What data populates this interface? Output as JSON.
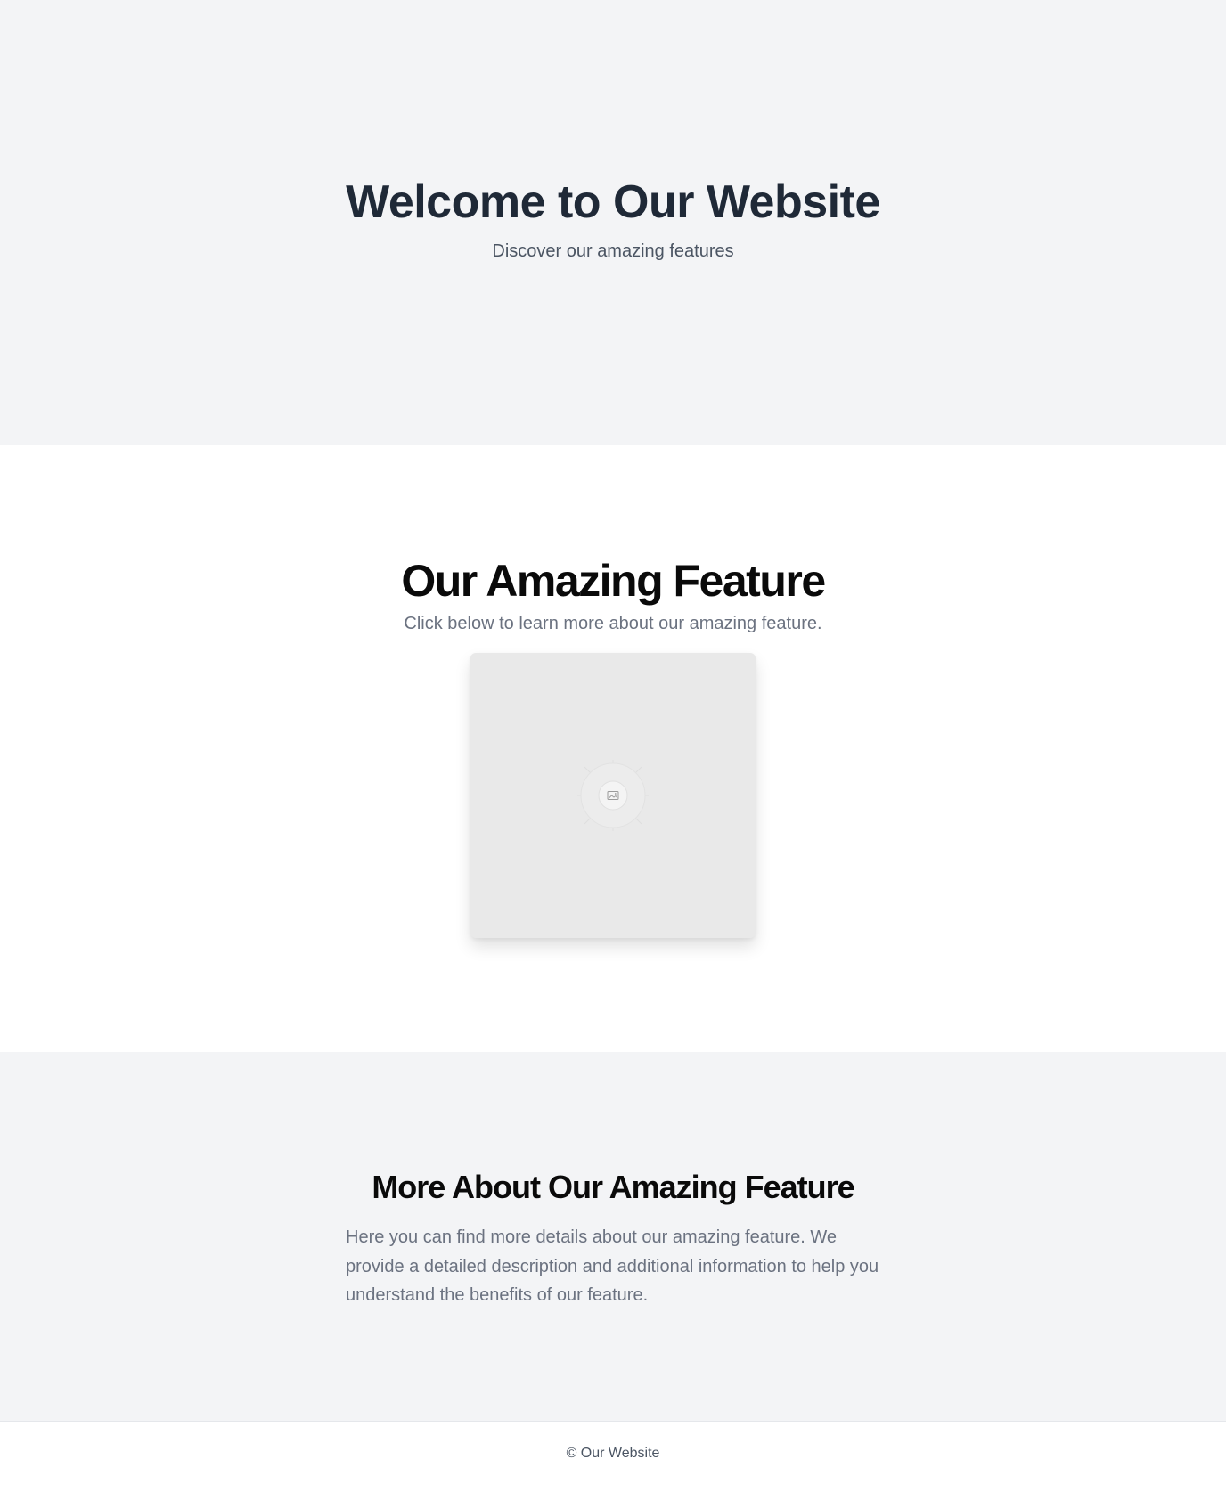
{
  "hero": {
    "title": "Welcome to Our Website",
    "subtitle": "Discover our amazing features"
  },
  "feature": {
    "title": "Our Amazing Feature",
    "text": "Click below to learn more about our amazing feature.",
    "image_icon": "image-icon"
  },
  "more": {
    "title": "More About Our Amazing Feature",
    "text": "Here you can find more details about our amazing feature. We provide a detailed description and additional information to help you understand the benefits of our feature."
  },
  "footer": {
    "text": "© Our Website"
  },
  "colors": {
    "hero_bg": "#f3f4f6",
    "heading": "#1f2937",
    "muted_text": "#6b7280",
    "image_bg": "#e9e9e9"
  }
}
